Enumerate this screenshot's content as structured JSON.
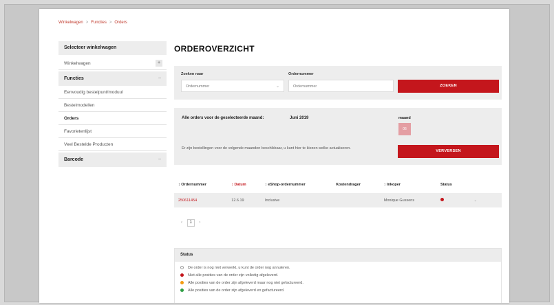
{
  "breadcrumb": [
    "Winkelwagen",
    "Functies",
    "Orders"
  ],
  "sidebar": {
    "select_title": "Selecteer winkelwagen",
    "items": [
      {
        "label": "Winkelwagen",
        "kind": "row",
        "toggle": "+"
      },
      {
        "label": "Functies",
        "kind": "group",
        "toggle": "–"
      },
      {
        "label": "Eenvoudig bestelpunt/moduul",
        "kind": "row"
      },
      {
        "label": "Bestelmodellen",
        "kind": "row"
      },
      {
        "label": "Orders",
        "kind": "row",
        "active": true
      },
      {
        "label": "Favorietenlijst",
        "kind": "row"
      },
      {
        "label": "Veel Bestelde Producten",
        "kind": "row"
      },
      {
        "label": "Barcode",
        "kind": "group",
        "toggle": "–"
      }
    ]
  },
  "main": {
    "title": "ORDEROVERZICHT",
    "search": {
      "zoeken_op_label": "Zoeken naar",
      "zoeken_op_value": "Ordernummer",
      "ordernummer_label": "Ordernummer",
      "ordernummer_placeholder": "Ordernummer",
      "button": "ZOEKEN"
    },
    "info": {
      "title": "Alle orders voor de geselecteerde maand:",
      "date": "Juni 2019",
      "maand_label": "maand",
      "maand_value": "06",
      "text": "Er zijn bestellingen voor de volgende maanden beschikbaar, u kunt hier te kiezen welke actualiseren.",
      "button": "VERVERSEN"
    },
    "table": {
      "headers": [
        "↕ Ordernummer",
        "↕ Datum",
        "↕ eShop-ordernummer",
        "Kostendrager",
        "↕ Inkoper",
        "Status"
      ],
      "rows": [
        {
          "ordernummer": "250611454",
          "datum": "12.6.19",
          "eshop": "Inclusive",
          "kostendrager": "",
          "inkoper": "Monique Gussens",
          "status_color": "#c4161c"
        }
      ]
    },
    "pager": {
      "prev": "‹",
      "current": "1",
      "next": "›"
    },
    "status": {
      "title": "Status",
      "legend": [
        {
          "color": "#ffffff",
          "text": "De order is nog niet verwerkt, u kunt de order nog annuleren."
        },
        {
          "color": "#c4161c",
          "text": "Niet alle posities van de order zijn volledig afgeleverd."
        },
        {
          "color": "#f39c12",
          "text": "Alle posities van de order zijn afgeleverd maar nog niet gefactureerd."
        },
        {
          "color": "#2e9e44",
          "text": "Alle posities van de order zijn afgeleverd en gefactureerd."
        }
      ]
    }
  }
}
